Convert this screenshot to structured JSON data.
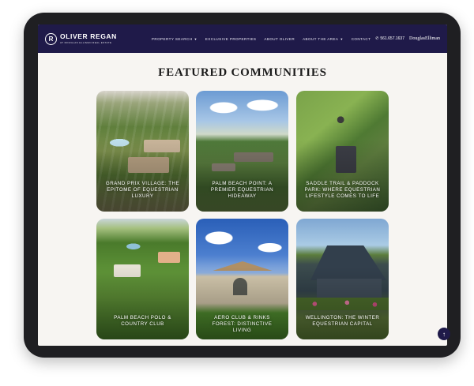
{
  "header": {
    "brand_mark": "R",
    "brand_name": "OLIVER REGAN",
    "brand_sub": "AT DOUGLAS ELLIMAN REAL ESTATE",
    "menu": [
      {
        "label": "PROPERTY SEARCH",
        "has_caret": true
      },
      {
        "label": "EXCLUSIVE PROPERTIES",
        "has_caret": false
      },
      {
        "label": "ABOUT OLIVER",
        "has_caret": false
      },
      {
        "label": "ABOUT THE AREA",
        "has_caret": true
      },
      {
        "label": "CONTACT",
        "has_caret": false
      }
    ],
    "phone": "561.657.1637",
    "partner_logo": "DouglasElliman",
    "colors": {
      "navbar": "#1f1a49"
    }
  },
  "main": {
    "title": "FEATURED COMMUNITIES",
    "communities": [
      {
        "label": "GRAND PRIX VILLAGE: THE EPITOME OF EQUESTRIAN LUXURY"
      },
      {
        "label": "PALM BEACH POINT: A PREMIER EQUESTRIAN HIDEAWAY"
      },
      {
        "label": "SADDLE TRAIL & PADDOCK PARK: WHERE EQUESTRIAN LIFESTYLE COMES TO LIFE"
      },
      {
        "label": "PALM BEACH POLO & COUNTRY CLUB"
      },
      {
        "label": "AERO CLUB & RINKS FOREST: DISTINCTIVE LIVING"
      },
      {
        "label": "WELLINGTON: THE WINTER EQUESTRIAN CAPITAL"
      }
    ]
  },
  "icons": {
    "phone": "phone-icon",
    "scroll_top": "arrow-up-icon",
    "caret": "chevron-down-icon"
  }
}
